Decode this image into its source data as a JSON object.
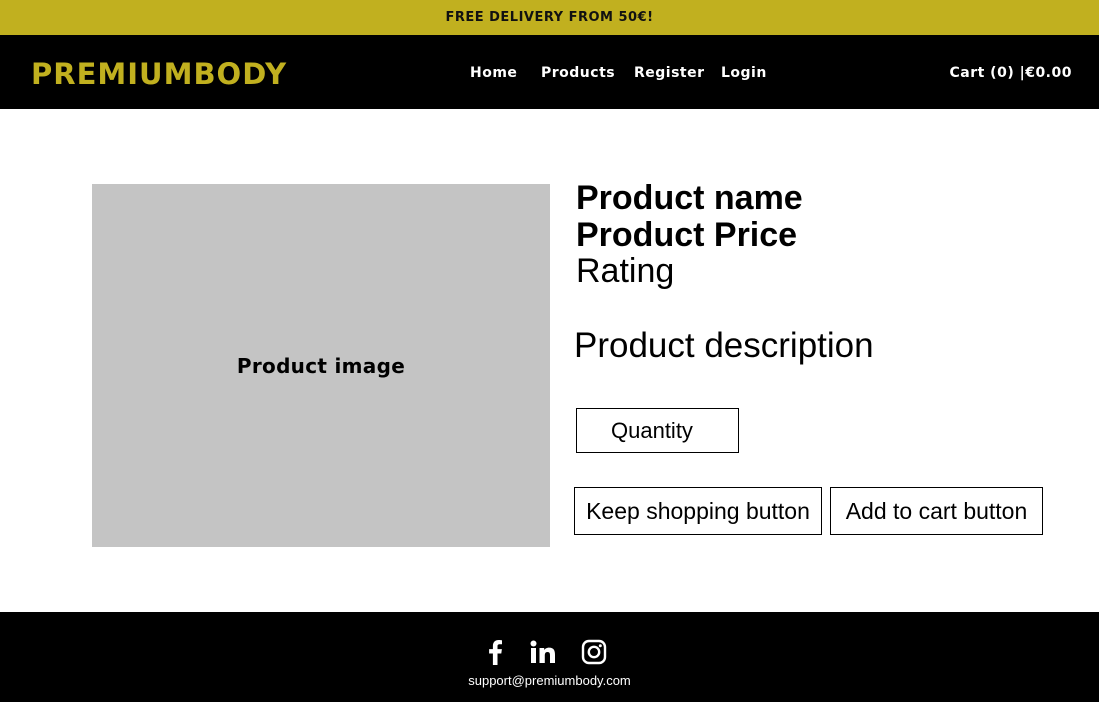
{
  "promo": {
    "text": "FREE DELIVERY FROM 50€!"
  },
  "header": {
    "logo": "PREMIUMBODY",
    "nav": {
      "home": "Home",
      "products": "Products",
      "register": "Register",
      "login": "Login"
    },
    "cart": "Cart (0) |€0.00"
  },
  "product": {
    "image_label": "Product image",
    "name": "Product name",
    "price": "Product Price",
    "rating": "Rating",
    "description": "Product description",
    "quantity_placeholder": "Quantity",
    "keep_shopping_label": "Keep shopping button",
    "add_to_cart_label": "Add to cart button"
  },
  "footer": {
    "social_icons": [
      "facebook-icon",
      "linkedin-icon",
      "instagram-icon"
    ],
    "email": "support@premiumbody.com"
  },
  "colors": {
    "accent": "#c1b01f",
    "header_bg": "#000000",
    "image_placeholder": "#c4c4c4"
  }
}
